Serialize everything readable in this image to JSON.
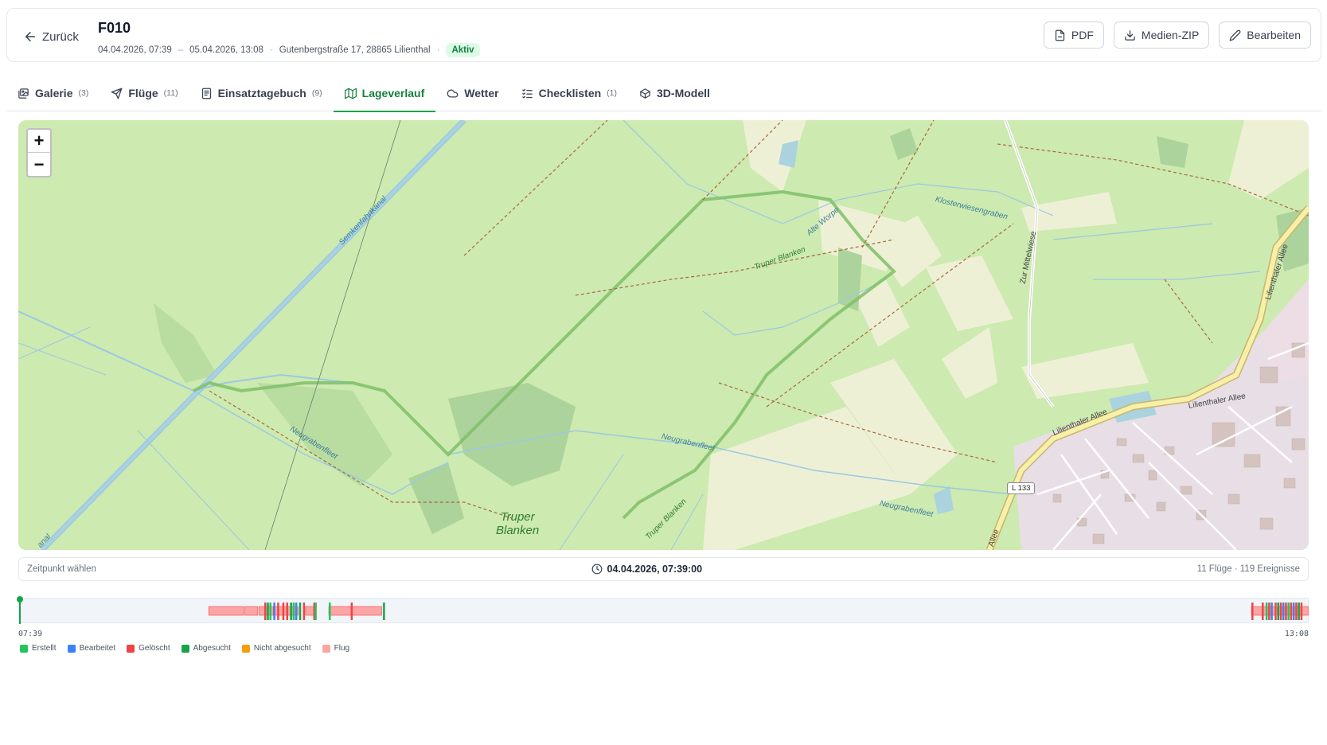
{
  "header": {
    "back_label": "Zurück",
    "title": "F010",
    "start": "04.04.2026, 07:39",
    "range_sep": "–",
    "end": "05.04.2026, 13:08",
    "address": "Gutenbergstraße 17, 28865 Lilienthal",
    "status": "Aktiv",
    "actions": {
      "pdf": "PDF",
      "zip": "Medien-ZIP",
      "edit": "Bearbeiten"
    }
  },
  "tabs": [
    {
      "label": "Galerie",
      "count": "(3)"
    },
    {
      "label": "Flüge",
      "count": "(11)"
    },
    {
      "label": "Einsatztagebuch",
      "count": "(9)"
    },
    {
      "label": "Lageverlauf",
      "count": ""
    },
    {
      "label": "Wetter",
      "count": ""
    },
    {
      "label": "Checklisten",
      "count": "(1)"
    },
    {
      "label": "3D-Modell",
      "count": ""
    }
  ],
  "active_tab": "Lageverlauf",
  "map": {
    "zoom_in": "+",
    "zoom_out": "−",
    "labels": {
      "semkenfahrtkanal": "Semkenfahrtkanal",
      "neugrabenfleet1": "Neugrabenfleet",
      "neugrabenfleet2": "Neugrabenfleet",
      "neugrabenfleet3": "Neugrabenfleet",
      "truper_blanken_small": "Truper Blanken",
      "truper_blanken_small2": "Truper Blanken",
      "truper_blanken_big_1": "Truper",
      "truper_blanken_big_2": "Blanken",
      "alte_worpe": "Alte Worpe",
      "klosterwiesengraben": "Klosterwiesengraben",
      "zur_mittelwiese": "Zur Mittelwiese",
      "lilienthaler_allee": "Lilienthaler Allee",
      "lilienthaler_allee2": "Lilienthaler Allee",
      "lilienthaler_allee3": "Lilienthaler Allee",
      "kanal": "anal",
      "allee": "Allee",
      "l133": "L 133"
    }
  },
  "timebar": {
    "left": "Zeitpunkt wählen",
    "current": "04.04.2026, 07:39:00",
    "right": "11 Flüge · 119 Ereignisse"
  },
  "timeline": {
    "start_label": "07:39",
    "end_label": "13:08",
    "flights": [
      [
        0.147,
        0.174
      ],
      [
        0.175,
        0.185
      ],
      [
        0.186,
        0.197
      ],
      [
        0.198,
        0.215
      ],
      [
        0.215,
        0.216
      ],
      [
        0.222,
        0.23
      ],
      [
        0.24,
        0.281
      ],
      [
        0.955,
        0.974
      ],
      [
        0.975,
        0.999
      ]
    ],
    "events": [
      {
        "t": 0.19,
        "type": "geloescht"
      },
      {
        "t": 0.192,
        "type": "abgesucht"
      },
      {
        "t": 0.194,
        "type": "erstellt"
      },
      {
        "t": 0.197,
        "type": "bearbeitet"
      },
      {
        "t": 0.2,
        "type": "geloescht"
      },
      {
        "t": 0.204,
        "type": "geloescht"
      },
      {
        "t": 0.207,
        "type": "geloescht"
      },
      {
        "t": 0.21,
        "type": "abgesucht"
      },
      {
        "t": 0.212,
        "type": "erstellt"
      },
      {
        "t": 0.214,
        "type": "bearbeitet"
      },
      {
        "t": 0.217,
        "type": "abgesucht"
      },
      {
        "t": 0.22,
        "type": "geloescht"
      },
      {
        "t": 0.228,
        "type": "geloescht"
      },
      {
        "t": 0.229,
        "type": "geloescht"
      },
      {
        "t": 0.229,
        "type": "erstellt"
      },
      {
        "t": 0.24,
        "type": "erstellt"
      },
      {
        "t": 0.257,
        "type": "geloescht"
      },
      {
        "t": 0.282,
        "type": "abgesucht"
      },
      {
        "t": 0.955,
        "type": "geloescht"
      },
      {
        "t": 0.963,
        "type": "geloescht"
      },
      {
        "t": 0.966,
        "type": "erstellt"
      },
      {
        "t": 0.968,
        "type": "geloescht"
      },
      {
        "t": 0.97,
        "type": "bearbeitet"
      },
      {
        "t": 0.973,
        "type": "geloescht"
      },
      {
        "t": 0.975,
        "type": "abgesucht"
      },
      {
        "t": 0.977,
        "type": "geloescht"
      },
      {
        "t": 0.979,
        "type": "bearbeitet"
      },
      {
        "t": 0.981,
        "type": "geloescht"
      },
      {
        "t": 0.983,
        "type": "erstellt"
      },
      {
        "t": 0.985,
        "type": "geloescht"
      },
      {
        "t": 0.987,
        "type": "bearbeitet"
      },
      {
        "t": 0.989,
        "type": "geloescht"
      },
      {
        "t": 0.991,
        "type": "abgesucht"
      },
      {
        "t": 0.993,
        "type": "geloescht"
      }
    ]
  },
  "legend": [
    {
      "key": "erstellt",
      "label": "Erstellt",
      "color": "#22c55e"
    },
    {
      "key": "bearbeitet",
      "label": "Bearbeitet",
      "color": "#3b82f6"
    },
    {
      "key": "geloescht",
      "label": "Gelöscht",
      "color": "#ef4444"
    },
    {
      "key": "abgesucht",
      "label": "Abgesucht",
      "color": "#16a34a"
    },
    {
      "key": "nicht_abgesucht",
      "label": "Nicht abgesucht",
      "color": "#f59e0b"
    },
    {
      "key": "flug",
      "label": "Flug",
      "color": "#fca5a5"
    }
  ]
}
